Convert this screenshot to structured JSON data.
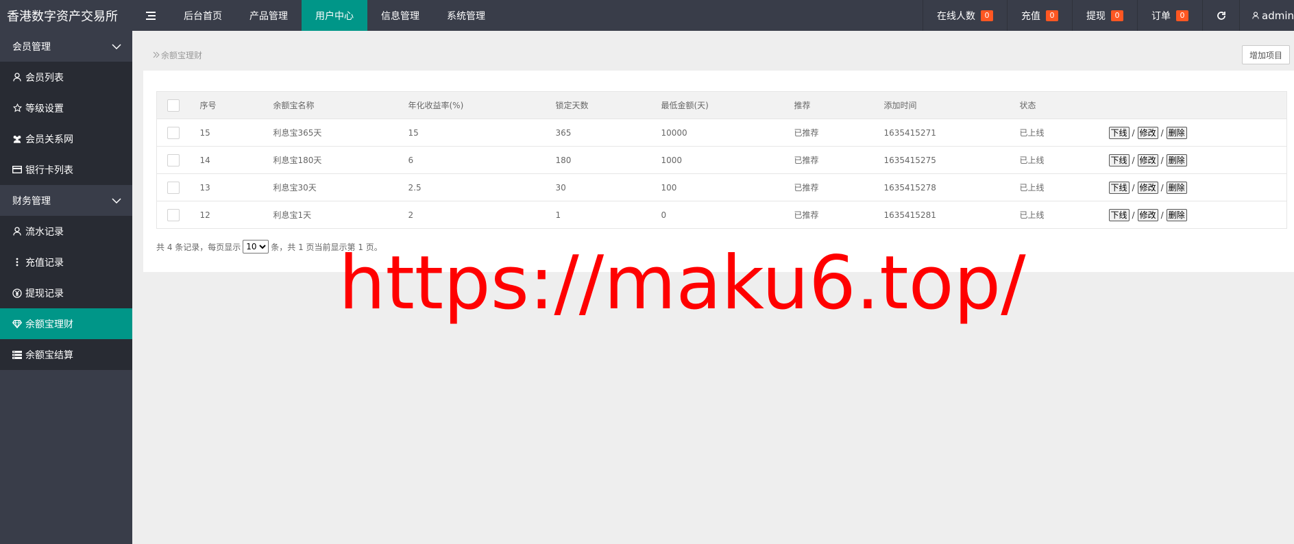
{
  "app_title": "香港数字资产交易所",
  "nav": [
    "后台首页",
    "产品管理",
    "用户中心",
    "信息管理",
    "系统管理"
  ],
  "nav_active_index": 2,
  "top_stats": [
    {
      "label": "在线人数",
      "count": "0"
    },
    {
      "label": "充值",
      "count": "0"
    },
    {
      "label": "提现",
      "count": "0"
    },
    {
      "label": "订单",
      "count": "0"
    }
  ],
  "user_name": "admin",
  "sidebar": {
    "groups": [
      {
        "title": "会员管理",
        "items": [
          {
            "label": "会员列表",
            "icon": "user-icon"
          },
          {
            "label": "等级设置",
            "icon": "star-icon"
          },
          {
            "label": "会员关系网",
            "icon": "users-icon"
          },
          {
            "label": "银行卡列表",
            "icon": "credit-card-icon"
          }
        ]
      },
      {
        "title": "财务管理",
        "items": [
          {
            "label": "流水记录",
            "icon": "user-icon"
          },
          {
            "label": "充值记录",
            "icon": "vertical-dots-icon"
          },
          {
            "label": "提现记录",
            "icon": "yen-icon"
          },
          {
            "label": "余额宝理财",
            "icon": "diamond-icon"
          },
          {
            "label": "余额宝结算",
            "icon": "server-icon"
          }
        ]
      }
    ],
    "active_item": "余额宝理财"
  },
  "breadcrumb": "余额宝理财",
  "add_button_label": "增加项目",
  "table": {
    "columns": [
      "序号",
      "余额宝名称",
      "年化收益率(%)",
      "锁定天数",
      "最低金额(天)",
      "推荐",
      "添加时间",
      "状态"
    ],
    "rows": [
      {
        "id": "15",
        "name": "利息宝365天",
        "rate": "15",
        "days": "365",
        "min": "10000",
        "rec": "已推荐",
        "time": "1635415271",
        "status": "已上线"
      },
      {
        "id": "14",
        "name": "利息宝180天",
        "rate": "6",
        "days": "180",
        "min": "1000",
        "rec": "已推荐",
        "time": "1635415275",
        "status": "已上线"
      },
      {
        "id": "13",
        "name": "利息宝30天",
        "rate": "2.5",
        "days": "30",
        "min": "100",
        "rec": "已推荐",
        "time": "1635415278",
        "status": "已上线"
      },
      {
        "id": "12",
        "name": "利息宝1天",
        "rate": "2",
        "days": "1",
        "min": "0",
        "rec": "已推荐",
        "time": "1635415281",
        "status": "已上线"
      }
    ],
    "actions": [
      "下线",
      "修改",
      "删除"
    ],
    "action_separator": "/"
  },
  "pager": {
    "prefix": "共 4 条记录，每页显示",
    "page_size": "10",
    "suffix": "条，共 1 页当前显示第 1 页。"
  },
  "watermark": "https://maku6.top/"
}
